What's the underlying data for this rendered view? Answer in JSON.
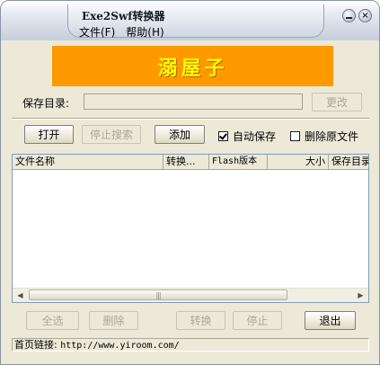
{
  "window": {
    "title": "Exe2Swf转换器",
    "minimize_glyph": "",
    "close_glyph": "×",
    "menu": [
      "文件(F)",
      "帮助(H)"
    ]
  },
  "banner": {
    "text": "溺屋子",
    "bg": "#ff9900",
    "fg": "#ffff00"
  },
  "save_dir": {
    "label": "保存目录:",
    "value": "",
    "change_button": "更改"
  },
  "buttons": {
    "open": "打开",
    "stop_search": "停止搜索",
    "add": "添加",
    "select_all": "全选",
    "delete": "删除",
    "convert": "转换",
    "stop": "停止",
    "exit": "退出"
  },
  "options": {
    "auto_save": {
      "label": "自动保存",
      "checked": true
    },
    "delete_original": {
      "label": "删除原文件",
      "checked": false
    }
  },
  "list": {
    "columns": [
      "文件名称",
      "转换...",
      "Flash版本",
      "大小",
      "保存目录"
    ],
    "rows": []
  },
  "status": {
    "label": "首页链接:",
    "url": "http://www.yiroom.com/"
  }
}
